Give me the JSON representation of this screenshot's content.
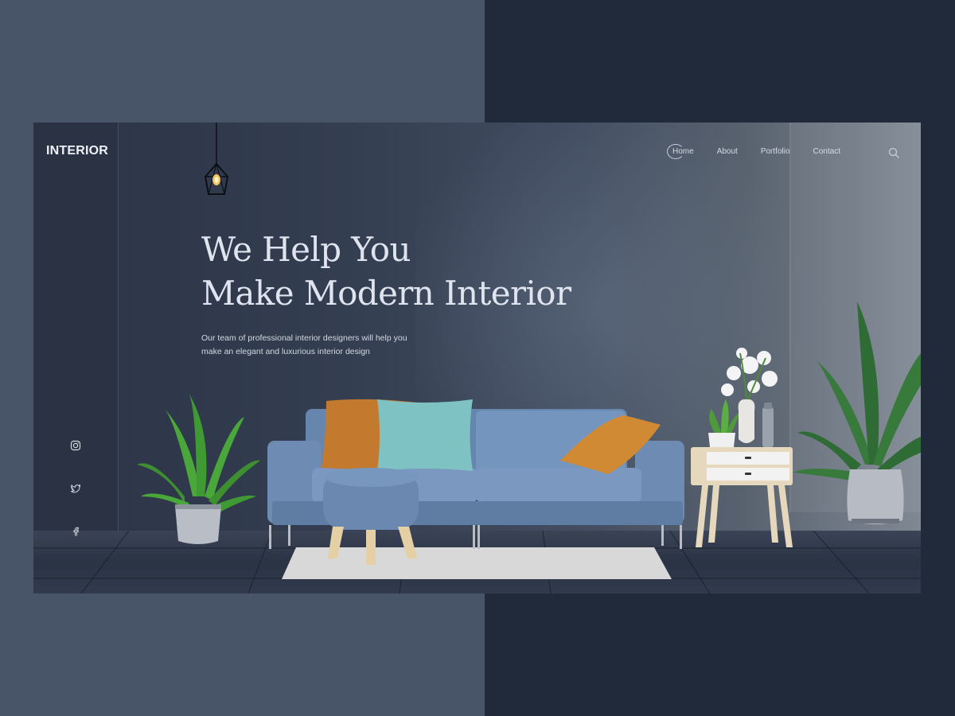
{
  "brand": {
    "logo_text": "INTERIOR"
  },
  "nav": {
    "items": [
      {
        "label": "Home",
        "active": true
      },
      {
        "label": "About",
        "active": false
      },
      {
        "label": "Portfolio",
        "active": false
      },
      {
        "label": "Contact",
        "active": false
      }
    ]
  },
  "hero": {
    "title_line1": "We Help You",
    "title_line2": "Make Modern Interior",
    "desc_line1": "Our team of professional interior designers will help you",
    "desc_line2": "make an elegant and luxurious interior design"
  },
  "social": [
    "instagram-icon",
    "twitter-icon",
    "facebook-icon"
  ],
  "colors": {
    "sofa": "#6f8db5",
    "pillow_orange": "#c47a2e",
    "pillow_teal": "#7ec2c3",
    "plant_green": "#3d8f2f"
  }
}
